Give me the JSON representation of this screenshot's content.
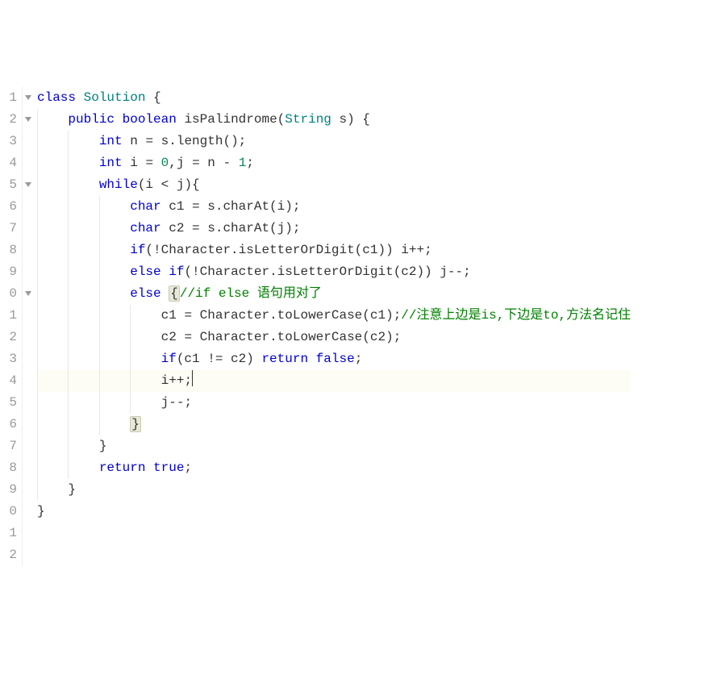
{
  "editor": {
    "language": "java",
    "current_line": 14,
    "cursor_column": 24,
    "fold_lines": [
      1,
      2,
      5,
      10
    ],
    "lines": [
      {
        "num": "1",
        "guides": [],
        "tokens": [
          {
            "t": "kw",
            "v": "class"
          },
          {
            "t": "pn",
            "v": " "
          },
          {
            "t": "cls",
            "v": "Solution"
          },
          {
            "t": "pn",
            "v": " {"
          }
        ]
      },
      {
        "num": "2",
        "guides": [
          0
        ],
        "tokens": [
          {
            "t": "pn",
            "v": "    "
          },
          {
            "t": "kw",
            "v": "public"
          },
          {
            "t": "pn",
            "v": " "
          },
          {
            "t": "type",
            "v": "boolean"
          },
          {
            "t": "pn",
            "v": " "
          },
          {
            "t": "meth",
            "v": "isPalindrome"
          },
          {
            "t": "pn",
            "v": "("
          },
          {
            "t": "cls",
            "v": "String"
          },
          {
            "t": "pn",
            "v": " s) {"
          }
        ]
      },
      {
        "num": "3",
        "guides": [
          0,
          1
        ],
        "tokens": [
          {
            "t": "pn",
            "v": "        "
          },
          {
            "t": "type",
            "v": "int"
          },
          {
            "t": "pn",
            "v": " n "
          },
          {
            "t": "op",
            "v": "="
          },
          {
            "t": "pn",
            "v": " s.length();"
          }
        ]
      },
      {
        "num": "4",
        "guides": [
          0,
          1
        ],
        "tokens": [
          {
            "t": "pn",
            "v": "        "
          },
          {
            "t": "type",
            "v": "int"
          },
          {
            "t": "pn",
            "v": " i "
          },
          {
            "t": "op",
            "v": "="
          },
          {
            "t": "pn",
            "v": " "
          },
          {
            "t": "num",
            "v": "0"
          },
          {
            "t": "pn",
            "v": ",j "
          },
          {
            "t": "op",
            "v": "="
          },
          {
            "t": "pn",
            "v": " n "
          },
          {
            "t": "op",
            "v": "-"
          },
          {
            "t": "pn",
            "v": " "
          },
          {
            "t": "num",
            "v": "1"
          },
          {
            "t": "pn",
            "v": ";"
          }
        ]
      },
      {
        "num": "5",
        "guides": [
          0,
          1
        ],
        "tokens": [
          {
            "t": "pn",
            "v": "        "
          },
          {
            "t": "kw",
            "v": "while"
          },
          {
            "t": "pn",
            "v": "(i "
          },
          {
            "t": "op",
            "v": "<"
          },
          {
            "t": "pn",
            "v": " j){"
          }
        ]
      },
      {
        "num": "6",
        "guides": [
          0,
          1,
          2
        ],
        "tokens": [
          {
            "t": "pn",
            "v": "            "
          },
          {
            "t": "type",
            "v": "char"
          },
          {
            "t": "pn",
            "v": " c1 "
          },
          {
            "t": "op",
            "v": "="
          },
          {
            "t": "pn",
            "v": " s.charAt(i);"
          }
        ]
      },
      {
        "num": "7",
        "guides": [
          0,
          1,
          2
        ],
        "tokens": [
          {
            "t": "pn",
            "v": "            "
          },
          {
            "t": "type",
            "v": "char"
          },
          {
            "t": "pn",
            "v": " c2 "
          },
          {
            "t": "op",
            "v": "="
          },
          {
            "t": "pn",
            "v": " s.charAt(j);"
          }
        ]
      },
      {
        "num": "8",
        "guides": [
          0,
          1,
          2
        ],
        "tokens": [
          {
            "t": "pn",
            "v": "            "
          },
          {
            "t": "kw",
            "v": "if"
          },
          {
            "t": "pn",
            "v": "("
          },
          {
            "t": "op",
            "v": "!"
          },
          {
            "t": "pn",
            "v": "Character.isLetterOrDigit(c1)) i"
          },
          {
            "t": "op",
            "v": "++"
          },
          {
            "t": "pn",
            "v": ";"
          }
        ]
      },
      {
        "num": "9",
        "guides": [
          0,
          1,
          2
        ],
        "tokens": [
          {
            "t": "pn",
            "v": "            "
          },
          {
            "t": "kw",
            "v": "else"
          },
          {
            "t": "pn",
            "v": " "
          },
          {
            "t": "kw",
            "v": "if"
          },
          {
            "t": "pn",
            "v": "("
          },
          {
            "t": "op",
            "v": "!"
          },
          {
            "t": "pn",
            "v": "Character.isLetterOrDigit(c2)) j"
          },
          {
            "t": "op",
            "v": "--"
          },
          {
            "t": "pn",
            "v": ";"
          }
        ]
      },
      {
        "num": "0",
        "guides": [
          0,
          1,
          2
        ],
        "tokens": [
          {
            "t": "pn",
            "v": "            "
          },
          {
            "t": "kw",
            "v": "else"
          },
          {
            "t": "pn",
            "v": " "
          },
          {
            "t": "brace-match",
            "v": "{"
          },
          {
            "t": "cm",
            "v": "//if else 语句用对了"
          }
        ]
      },
      {
        "num": "1",
        "guides": [
          0,
          1,
          2,
          3
        ],
        "tokens": [
          {
            "t": "pn",
            "v": "                c1 "
          },
          {
            "t": "op",
            "v": "="
          },
          {
            "t": "pn",
            "v": " Character.toLowerCase(c1);"
          },
          {
            "t": "cm",
            "v": "//注意上边是is,下边是to,方法名记住"
          }
        ]
      },
      {
        "num": "2",
        "guides": [
          0,
          1,
          2,
          3
        ],
        "tokens": [
          {
            "t": "pn",
            "v": "                c2 "
          },
          {
            "t": "op",
            "v": "="
          },
          {
            "t": "pn",
            "v": " Character.toLowerCase(c2);"
          }
        ]
      },
      {
        "num": "3",
        "guides": [
          0,
          1,
          2,
          3
        ],
        "tokens": [
          {
            "t": "pn",
            "v": "                "
          },
          {
            "t": "kw",
            "v": "if"
          },
          {
            "t": "pn",
            "v": "(c1 "
          },
          {
            "t": "op",
            "v": "!="
          },
          {
            "t": "pn",
            "v": " c2) "
          },
          {
            "t": "kw",
            "v": "return"
          },
          {
            "t": "pn",
            "v": " "
          },
          {
            "t": "bool",
            "v": "false"
          },
          {
            "t": "pn",
            "v": ";"
          }
        ]
      },
      {
        "num": "4",
        "guides": [
          0,
          1,
          2,
          3
        ],
        "hl": true,
        "tokens": [
          {
            "t": "pn",
            "v": "                i"
          },
          {
            "t": "op",
            "v": "++"
          },
          {
            "t": "pn",
            "v": ";"
          },
          {
            "t": "cursor",
            "v": ""
          }
        ]
      },
      {
        "num": "5",
        "guides": [
          0,
          1,
          2,
          3
        ],
        "tokens": [
          {
            "t": "pn",
            "v": "                j"
          },
          {
            "t": "op",
            "v": "--"
          },
          {
            "t": "pn",
            "v": ";"
          }
        ]
      },
      {
        "num": "6",
        "guides": [
          0,
          1,
          2
        ],
        "tokens": [
          {
            "t": "pn",
            "v": "            "
          },
          {
            "t": "brace-match",
            "v": "}"
          }
        ]
      },
      {
        "num": "7",
        "guides": [
          0,
          1
        ],
        "tokens": [
          {
            "t": "pn",
            "v": "        }"
          }
        ]
      },
      {
        "num": "8",
        "guides": [
          0,
          1
        ],
        "tokens": [
          {
            "t": "pn",
            "v": "        "
          },
          {
            "t": "kw",
            "v": "return"
          },
          {
            "t": "pn",
            "v": " "
          },
          {
            "t": "bool",
            "v": "true"
          },
          {
            "t": "pn",
            "v": ";"
          }
        ]
      },
      {
        "num": "9",
        "guides": [
          0
        ],
        "tokens": [
          {
            "t": "pn",
            "v": "    }"
          }
        ]
      },
      {
        "num": "0",
        "guides": [],
        "tokens": [
          {
            "t": "pn",
            "v": "}"
          }
        ]
      },
      {
        "num": "1",
        "guides": [],
        "tokens": []
      },
      {
        "num": "2",
        "guides": [],
        "tokens": []
      }
    ]
  }
}
